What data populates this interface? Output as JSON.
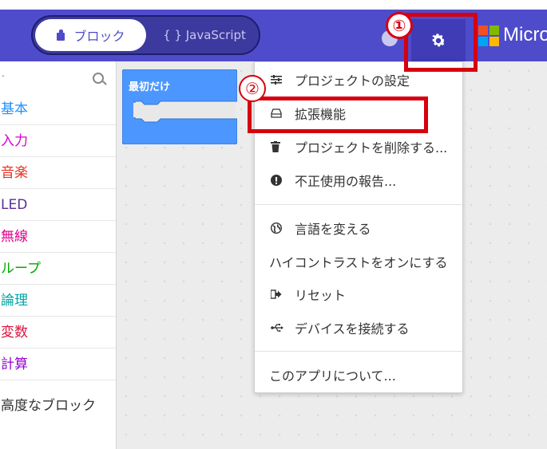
{
  "header": {
    "toggle": {
      "blocks_label": "ブロック",
      "javascript_label": "{ } JavaScript"
    },
    "brand": "Micro",
    "accent_color": "#4f4ccc"
  },
  "annotations": {
    "badge1": "①",
    "badge2": "②"
  },
  "sidebar": {
    "search_placeholder": ".",
    "categories": [
      {
        "label": "基本",
        "color": "#1e90ff"
      },
      {
        "label": "入力",
        "color": "#d400d4"
      },
      {
        "label": "音楽",
        "color": "#e63022"
      },
      {
        "label": "LED",
        "color": "#5c2d91"
      },
      {
        "label": "無線",
        "color": "#e3008c"
      },
      {
        "label": "ループ",
        "color": "#00aa00"
      },
      {
        "label": "論理",
        "color": "#00a4a6"
      },
      {
        "label": "変数",
        "color": "#dc143c"
      },
      {
        "label": "計算",
        "color": "#9400d3"
      }
    ],
    "advanced_label": "高度なブロック"
  },
  "workspace": {
    "block_label": "最初だけ"
  },
  "menu": {
    "items": [
      {
        "label": "プロジェクトの設定",
        "icon": "sliders-icon"
      },
      {
        "label": "拡張機能",
        "icon": "drive-icon"
      },
      {
        "label": "プロジェクトを削除する...",
        "icon": "trash-icon"
      },
      {
        "label": "不正使用の報告...",
        "icon": "alert-icon"
      },
      {
        "label": "言語を変える",
        "icon": "globe-icon"
      },
      {
        "label": "ハイコントラストをオンにする",
        "icon": ""
      },
      {
        "label": "リセット",
        "icon": "signout-icon"
      },
      {
        "label": "デバイスを接続する",
        "icon": "usb-icon"
      },
      {
        "label": "このアプリについて...",
        "icon": ""
      }
    ]
  }
}
